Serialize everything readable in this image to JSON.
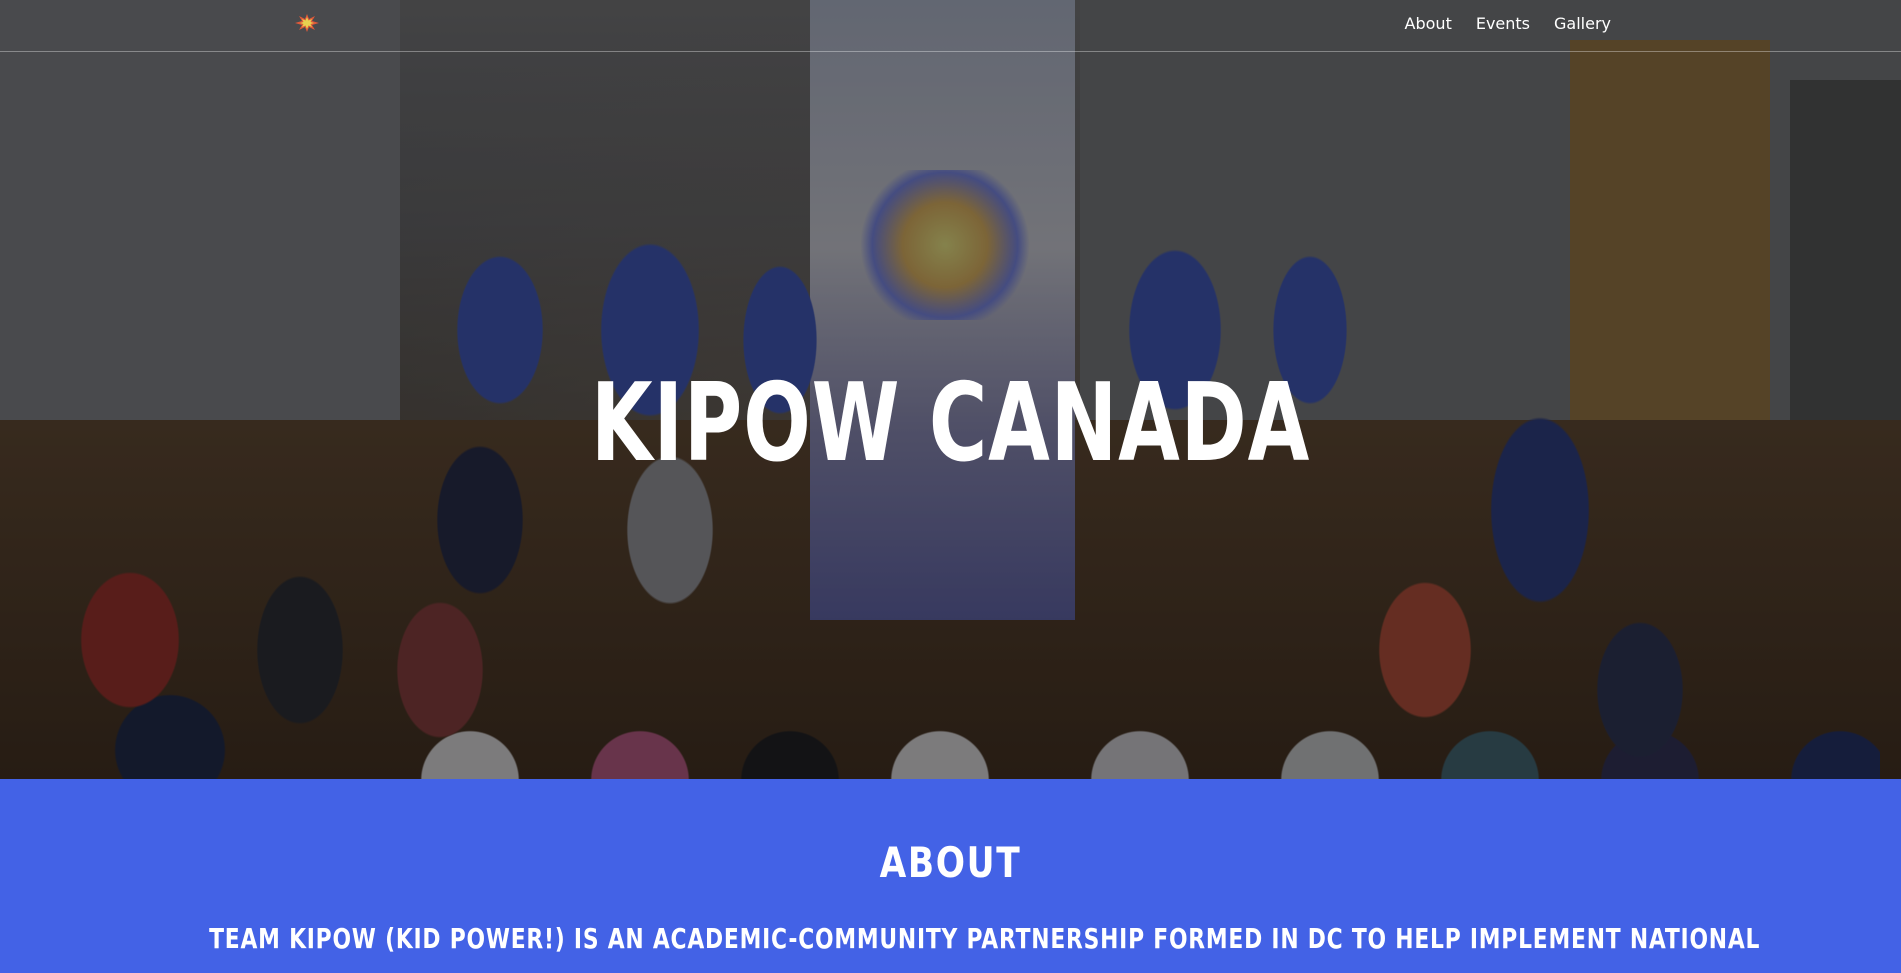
{
  "nav": {
    "logo_alt": "KIPOW logo",
    "links": [
      {
        "label": "About"
      },
      {
        "label": "Events"
      },
      {
        "label": "Gallery"
      }
    ]
  },
  "hero": {
    "title": "KIPOW CANADA",
    "image_description_icon": "group-photo"
  },
  "about": {
    "heading": "ABOUT",
    "text": "TEAM KIPOW (KID POWER!) IS AN ACADEMIC-COMMUNITY PARTNERSHIP FORMED IN DC TO HELP IMPLEMENT NATIONAL"
  },
  "colors": {
    "accent": "#4362e6",
    "text": "#ffffff"
  }
}
